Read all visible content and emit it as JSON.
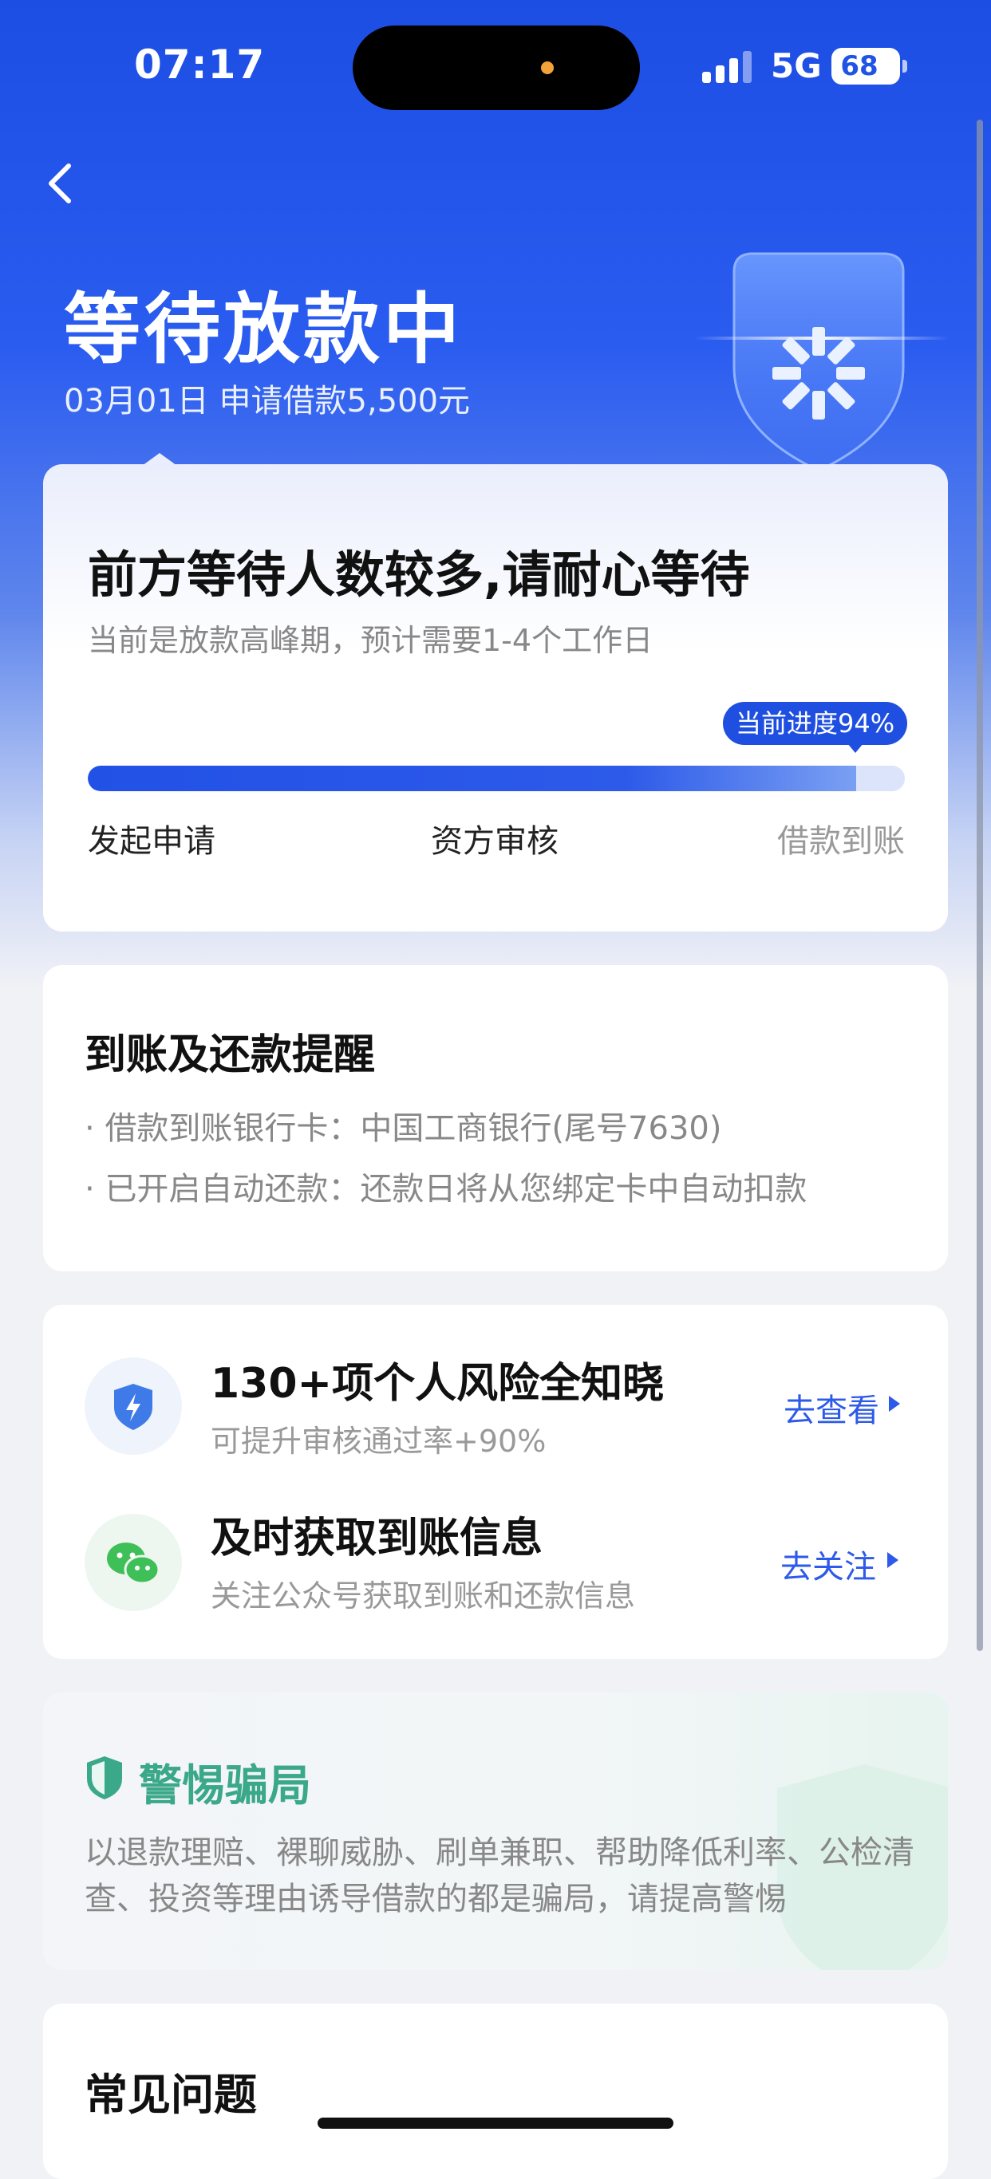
{
  "status_bar": {
    "time": "07:17",
    "network": "5G",
    "battery": "68"
  },
  "header": {
    "title": "等待放款中",
    "subtitle": "03月01日 申请借款5,500元"
  },
  "progress_card": {
    "heading": "前方等待人数较多,请耐心等待",
    "subheading": "当前是放款高峰期，预计需要1-4个工作日",
    "badge": "当前进度94%",
    "progress": 0.94,
    "steps": [
      "发起申请",
      "资方审核",
      "借款到账"
    ]
  },
  "reminder_card": {
    "heading": "到账及还款提醒",
    "items": [
      "借款到账银行卡：中国工商银行(尾号7630)",
      "已开启自动还款：还款日将从您绑定卡中自动扣款"
    ]
  },
  "features": [
    {
      "title": "130+项个人风险全知晓",
      "subtitle": "可提升审核通过率+90%",
      "link": "去查看",
      "icon": "shield-bolt-icon"
    },
    {
      "title": "及时获取到账信息",
      "subtitle": "关注公众号获取到账和还款信息",
      "link": "去关注",
      "icon": "wechat-icon"
    }
  ],
  "warning_card": {
    "title": "警惕骗局",
    "body": "以退款理赔、裸聊威胁、刷单兼职、帮助降低利率、公检清查、投资等理由诱导借款的都是骗局，请提高警惕"
  },
  "faq_card": {
    "heading": "常见问题"
  },
  "colors": {
    "primary": "#1f4fe0",
    "link": "#2d5ae9",
    "warning_green": "#3aa889"
  }
}
